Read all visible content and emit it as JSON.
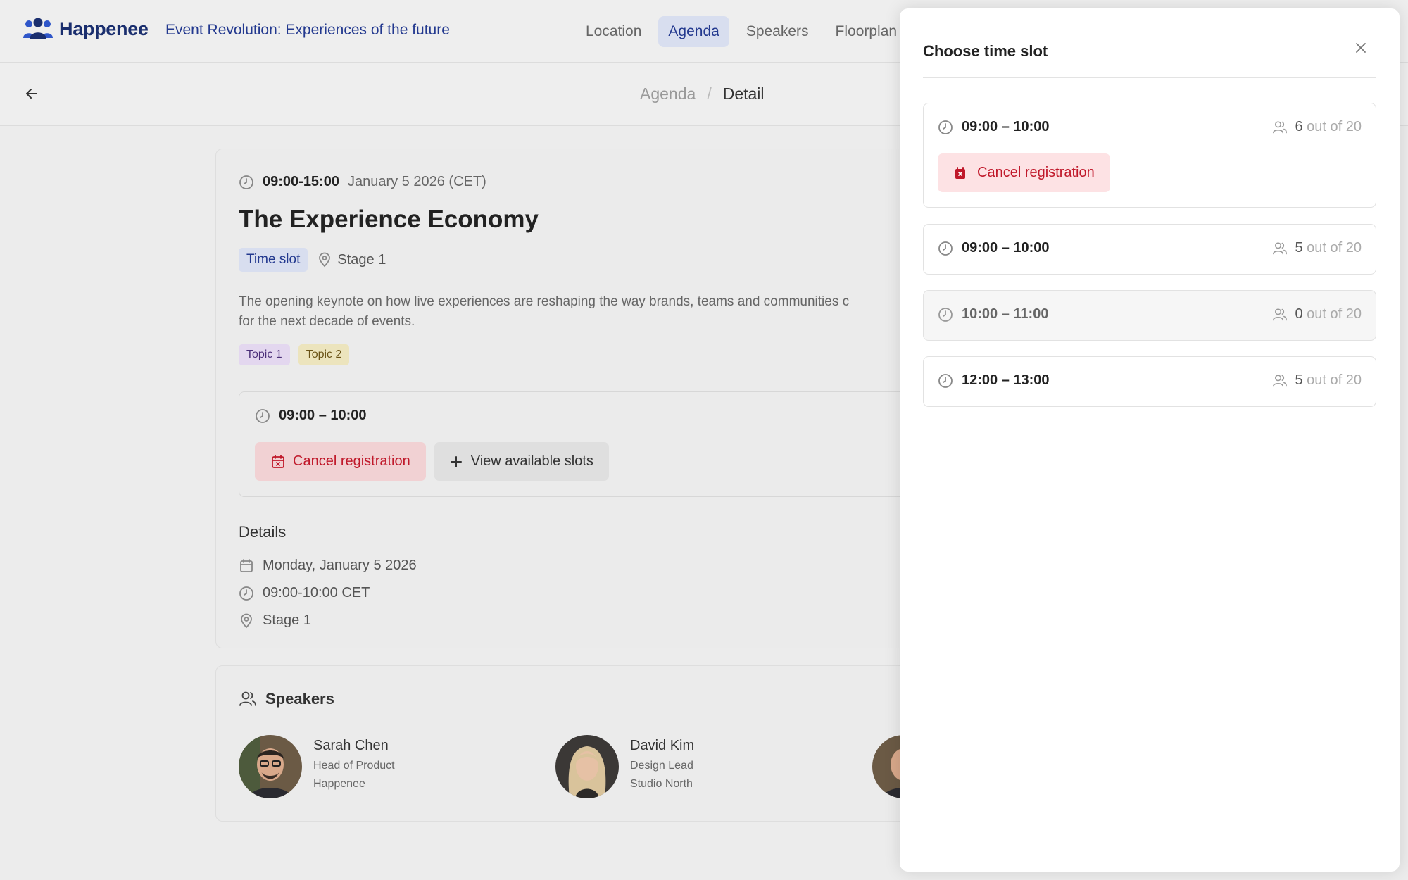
{
  "header": {
    "brand": "Happenee",
    "event_title": "Event Revolution: Experiences of the future",
    "nav": [
      {
        "label": "Location"
      },
      {
        "label": "Agenda",
        "active": true
      },
      {
        "label": "Speakers"
      },
      {
        "label": "Floorplan"
      }
    ]
  },
  "breadcrumb": {
    "parent": "Agenda",
    "separator": "/",
    "current": "Detail"
  },
  "session": {
    "time_range": "09:00-15:00",
    "date": "January 5 2026 (CET)",
    "title": "The Experience Economy",
    "type_badge": "Time slot",
    "location": "Stage 1",
    "description": "The opening keynote on how live experiences are reshaping the way brands, teams and communities c\nfor the next decade of events.",
    "topics": [
      "Topic 1",
      "Topic 2"
    ]
  },
  "registration": {
    "time": "09:00 – 10:00",
    "cancel_label": "Cancel registration",
    "view_label": "View available slots"
  },
  "details": {
    "heading": "Details",
    "date": "Monday, January 5 2026",
    "time": "09:00-10:00 CET",
    "location": "Stage 1"
  },
  "speakers": {
    "heading": "Speakers",
    "items": [
      {
        "name": "Sarah Chen",
        "role": "Head of Product",
        "company": "Happenee"
      },
      {
        "name": "David Kim",
        "role": "Design Lead",
        "company": "Studio North"
      }
    ]
  },
  "panel": {
    "title": "Choose time slot",
    "slots": [
      {
        "time": "09:00 – 10:00",
        "taken": "6",
        "capacity": "out of 20",
        "registered": true,
        "cancel_label": "Cancel registration"
      },
      {
        "time": "09:00 – 10:00",
        "taken": "5",
        "capacity": "out of 20"
      },
      {
        "time": "10:00 – 11:00",
        "taken": "0",
        "capacity": "out of 20",
        "disabled": true
      },
      {
        "time": "12:00 – 13:00",
        "taken": "5",
        "capacity": "out of 20"
      }
    ]
  },
  "colors": {
    "brand": "#1a2e6e",
    "accent": "#23398f",
    "danger": "#c0182a"
  }
}
